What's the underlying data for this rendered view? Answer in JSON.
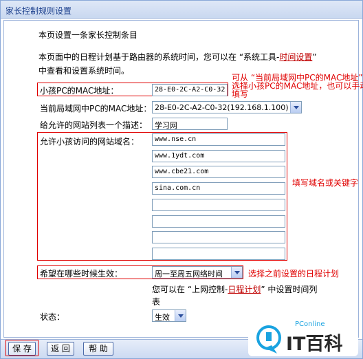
{
  "title": "家长控制规则设置",
  "intro": "本页设置一条家长控制条目",
  "desc": {
    "line1": "本页面中的日程计划基于路由器的系统时间，您可以在 “系统工具-",
    "link": "时间设置",
    "line1_end": "”",
    "line2": "中查看和设置系统时间。"
  },
  "form": {
    "child_mac_label": "小孩PC的MAC地址：",
    "child_mac_value": "28-E0-2C-A2-C0-32",
    "lan_mac_label": "当前局域网中PC的MAC地址：",
    "lan_mac_value": "28-E0-2C-A2-C0-32(192.168.1.100)",
    "desc_label": "给允许的网站列表一个描述：",
    "desc_value": "学习网",
    "domains_label": "允许小孩访问的网站域名：",
    "domains": [
      "www.nse.cn",
      "www.1ydt.com",
      "www.cbe21.com",
      "sina.com.cn",
      "",
      "",
      "",
      ""
    ],
    "schedule_label": "希望在哪些时候生效：",
    "schedule_value": "周一至周五网络时间",
    "schedule_hint_pre": "您可以在 “上网控制-",
    "schedule_hint_link": "日程计划",
    "schedule_hint_post": "” 中设置时间列",
    "schedule_hint_line2": "表",
    "status_label": "状态：",
    "status_value": "生效"
  },
  "annotations": {
    "mac_line1": "可从 “当前局域网中PC的MAC地址”",
    "mac_line2": "选择小孩PC的MAC地址，也可以手动",
    "mac_line3": "填写",
    "domains_note": "填写域名或关键字",
    "schedule_note": "选择之前设置的日程计划"
  },
  "buttons": {
    "save": "保 存",
    "back": "返 回",
    "help": "帮 助"
  },
  "watermark": {
    "brand_small": "PConline",
    "brand": "IT百科"
  },
  "colors": {
    "accent": "#1a3e8c",
    "annotation": "#e00000",
    "link": "#c00000"
  }
}
